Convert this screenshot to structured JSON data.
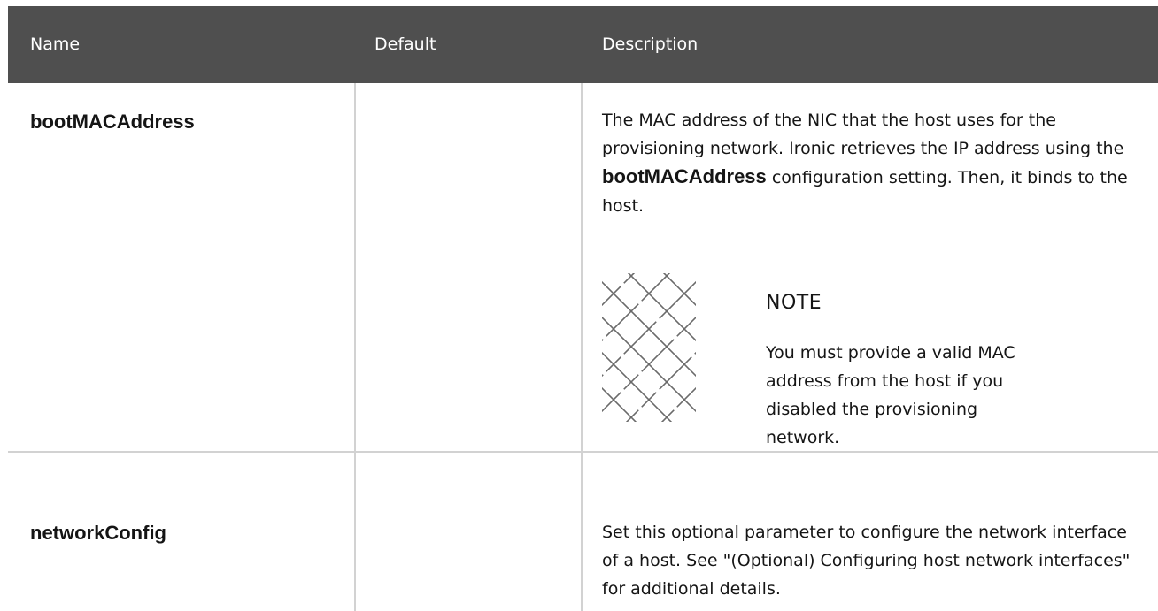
{
  "headers": {
    "name": "Name",
    "default": "Default",
    "description": "Description"
  },
  "rows": [
    {
      "name": "bootMACAddress",
      "default": "",
      "description_before": "The MAC address of the NIC that the host uses for the provisioning network. Ironic retrieves the IP address using the ",
      "description_bold": "bootMACAddress",
      "description_after": " configuration setting. Then, it binds to the host.",
      "note": {
        "title": "NOTE",
        "text": "You must provide a valid MAC address from the host if you disabled the provisioning network.",
        "icon": "note-pattern-icon"
      }
    },
    {
      "name": "networkConfig",
      "default": "",
      "description": "Set this optional parameter to configure the network interface of a host. See \"(Optional) Configuring host network interfaces\" for additional details."
    }
  ],
  "colors": {
    "header_bg": "#4f4f4f",
    "header_text": "#ffffff",
    "border": "#d2d2d2",
    "text": "#151515"
  }
}
